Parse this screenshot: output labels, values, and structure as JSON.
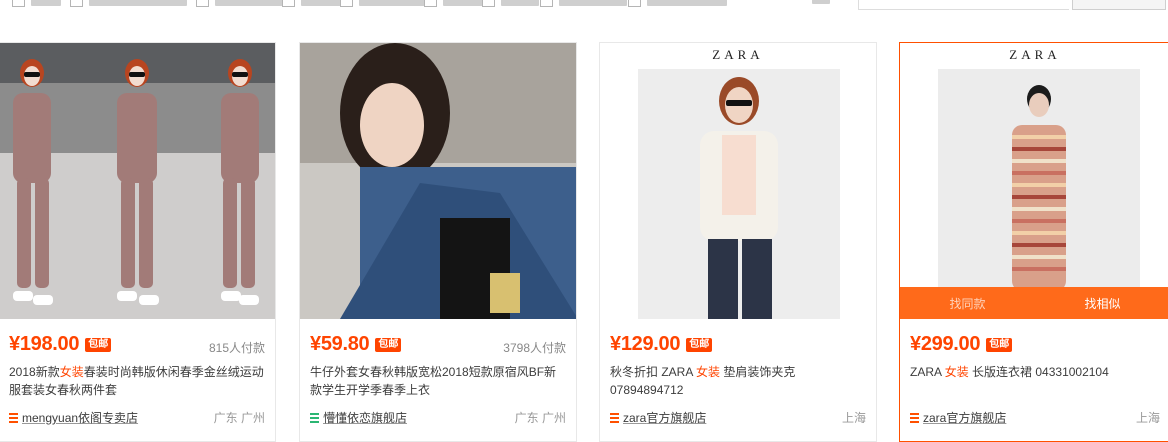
{
  "cards": [
    {
      "price": "¥198.00",
      "badge": "包邮",
      "paid": "815人付款",
      "title_pre": "2018新款",
      "title_hl": "女装",
      "title_post": "春装时尚韩版休闲春季金丝绒运动服套装女春秋两件套",
      "shop": "mengyuan依阁专卖店",
      "location": "广东 广州",
      "shop_icon": "store-icon-orange",
      "brand": ""
    },
    {
      "price": "¥59.80",
      "badge": "包邮",
      "paid": "3798人付款",
      "title_pre": "牛仔外套女春秋韩版宽松2018短款原宿风BF新款学生开学季春季上衣",
      "title_hl": "",
      "title_post": "",
      "shop": "懵懂依恋旗舰店",
      "location": "广东 广州",
      "shop_icon": "store-icon-green",
      "brand": ""
    },
    {
      "price": "¥129.00",
      "badge": "包邮",
      "paid": "",
      "title_pre": "秋冬折扣 ZARA ",
      "title_hl": "女装",
      "title_post": " 垫肩装饰夹克 07894894712",
      "shop_pre": "zara",
      "shop_post": "官方旗舰店",
      "location": "上海",
      "shop_icon": "store-icon-orange",
      "brand": "ZARA"
    },
    {
      "price": "¥299.00",
      "badge": "包邮",
      "paid": "",
      "title_pre": "ZARA ",
      "title_hl": "女装",
      "title_post": " 长版连衣裙 04331002104",
      "shop_pre": "zara",
      "shop_post": "官方旗舰店",
      "location": "上海",
      "shop_icon": "store-icon-orange",
      "brand": "ZARA",
      "overlay_left": "找同款",
      "overlay_right": "找相似"
    }
  ],
  "colors": {
    "price": "#ff4400",
    "accent": "#ff5000",
    "overlay": "#ff6a1a"
  }
}
